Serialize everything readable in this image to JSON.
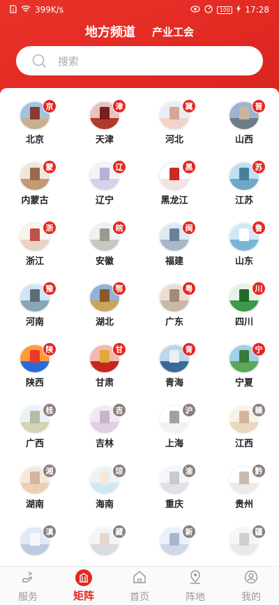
{
  "status_bar": {
    "speed": "399K/s",
    "battery": "100",
    "time": "17:28"
  },
  "header": {
    "title": "地方频道",
    "subtitle": "产业工会"
  },
  "search": {
    "placeholder": "搜索"
  },
  "regions": [
    {
      "name": "北京",
      "badge": "京",
      "faded": false
    },
    {
      "name": "天津",
      "badge": "津",
      "faded": false
    },
    {
      "name": "河北",
      "badge": "冀",
      "faded": false
    },
    {
      "name": "山西",
      "badge": "晋",
      "faded": false
    },
    {
      "name": "内蒙古",
      "badge": "蒙",
      "faded": false
    },
    {
      "name": "辽宁",
      "badge": "辽",
      "faded": false
    },
    {
      "name": "黑龙江",
      "badge": "黑",
      "faded": false
    },
    {
      "name": "江苏",
      "badge": "苏",
      "faded": false
    },
    {
      "name": "浙江",
      "badge": "浙",
      "faded": false
    },
    {
      "name": "安徽",
      "badge": "皖",
      "faded": false
    },
    {
      "name": "福建",
      "badge": "闽",
      "faded": false
    },
    {
      "name": "山东",
      "badge": "鲁",
      "faded": false
    },
    {
      "name": "河南",
      "badge": "豫",
      "faded": false
    },
    {
      "name": "湖北",
      "badge": "鄂",
      "faded": false
    },
    {
      "name": "广东",
      "badge": "粤",
      "faded": false
    },
    {
      "name": "四川",
      "badge": "川",
      "faded": false
    },
    {
      "name": "陕西",
      "badge": "陕",
      "faded": false
    },
    {
      "name": "甘肃",
      "badge": "甘",
      "faded": false
    },
    {
      "name": "青海",
      "badge": "青",
      "faded": false
    },
    {
      "name": "宁夏",
      "badge": "宁",
      "faded": false
    },
    {
      "name": "广西",
      "badge": "桂",
      "faded": true
    },
    {
      "name": "吉林",
      "badge": "吉",
      "faded": true
    },
    {
      "name": "上海",
      "badge": "沪",
      "faded": true
    },
    {
      "name": "江西",
      "badge": "赣",
      "faded": true
    },
    {
      "name": "湖南",
      "badge": "湘",
      "faded": true
    },
    {
      "name": "海南",
      "badge": "琼",
      "faded": true
    },
    {
      "name": "重庆",
      "badge": "渝",
      "faded": true
    },
    {
      "name": "贵州",
      "badge": "黔",
      "faded": true
    },
    {
      "name": "",
      "badge": "滇",
      "faded": true
    },
    {
      "name": "",
      "badge": "藏",
      "faded": true
    },
    {
      "name": "",
      "badge": "新",
      "faded": true
    },
    {
      "name": "",
      "badge": "疆",
      "faded": true
    }
  ],
  "tabs": [
    {
      "label": "服务",
      "icon": "service-icon",
      "active": false
    },
    {
      "label": "矩阵",
      "icon": "matrix-icon",
      "active": true
    },
    {
      "label": "首页",
      "icon": "home-icon",
      "active": false
    },
    {
      "label": "阵地",
      "icon": "location-icon",
      "active": false
    },
    {
      "label": "我的",
      "icon": "profile-icon",
      "active": false
    }
  ],
  "colors": {
    "brand_red": "#e3281f",
    "active_badge": "#e3281f",
    "faded_badge": "#8a7f7c"
  }
}
